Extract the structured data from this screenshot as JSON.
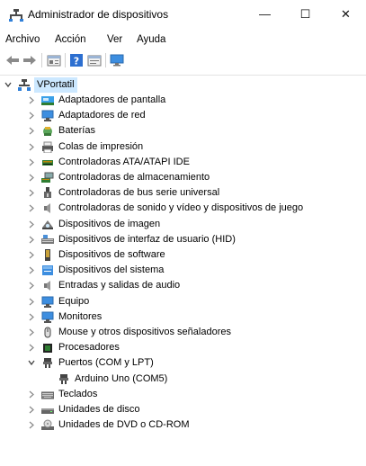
{
  "window": {
    "title": "Administrador de dispositivos",
    "controls": {
      "minimize": "—",
      "maximize": "☐",
      "close": "✕"
    }
  },
  "menu": [
    "Archivo",
    "Acción",
    "Ver",
    "Ayuda"
  ],
  "toolbar": {
    "icons": [
      "back-arrow-icon",
      "forward-arrow-icon",
      "properties-icon",
      "help-icon",
      "update-driver-icon",
      "monitor-icon"
    ]
  },
  "tree": {
    "root": "VPortatil",
    "items": [
      {
        "label": "Adaptadores de pantalla",
        "icon": "display-adapter-icon",
        "expanded": false
      },
      {
        "label": "Adaptadores de red",
        "icon": "network-adapter-icon",
        "expanded": false
      },
      {
        "label": "Baterías",
        "icon": "battery-icon",
        "expanded": false
      },
      {
        "label": "Colas de impresión",
        "icon": "printer-icon",
        "expanded": false
      },
      {
        "label": "Controladoras ATA/ATAPI IDE",
        "icon": "ide-controller-icon",
        "expanded": false
      },
      {
        "label": "Controladoras de almacenamiento",
        "icon": "storage-controller-icon",
        "expanded": false
      },
      {
        "label": "Controladoras de bus serie universal",
        "icon": "usb-icon",
        "expanded": false
      },
      {
        "label": "Controladoras de sonido y vídeo y dispositivos de juego",
        "icon": "speaker-icon",
        "expanded": false
      },
      {
        "label": "Dispositivos de imagen",
        "icon": "camera-icon",
        "expanded": false
      },
      {
        "label": "Dispositivos de interfaz de usuario (HID)",
        "icon": "hid-icon",
        "expanded": false
      },
      {
        "label": "Dispositivos de software",
        "icon": "software-device-icon",
        "expanded": false
      },
      {
        "label": "Dispositivos del sistema",
        "icon": "system-device-icon",
        "expanded": false
      },
      {
        "label": "Entradas y salidas de audio",
        "icon": "audio-io-icon",
        "expanded": false
      },
      {
        "label": "Equipo",
        "icon": "computer-icon",
        "expanded": false
      },
      {
        "label": "Monitores",
        "icon": "monitor-icon",
        "expanded": false
      },
      {
        "label": "Mouse y otros dispositivos señaladores",
        "icon": "mouse-icon",
        "expanded": false
      },
      {
        "label": "Procesadores",
        "icon": "processor-icon",
        "expanded": false
      },
      {
        "label": "Puertos (COM y LPT)",
        "icon": "port-icon",
        "expanded": true,
        "children": [
          "Arduino Uno (COM5)"
        ]
      },
      {
        "label": "Teclados",
        "icon": "keyboard-icon",
        "expanded": false
      },
      {
        "label": "Unidades de disco",
        "icon": "disk-drive-icon",
        "expanded": false
      },
      {
        "label": "Unidades de DVD o CD-ROM",
        "icon": "dvd-icon",
        "expanded": false
      }
    ]
  }
}
